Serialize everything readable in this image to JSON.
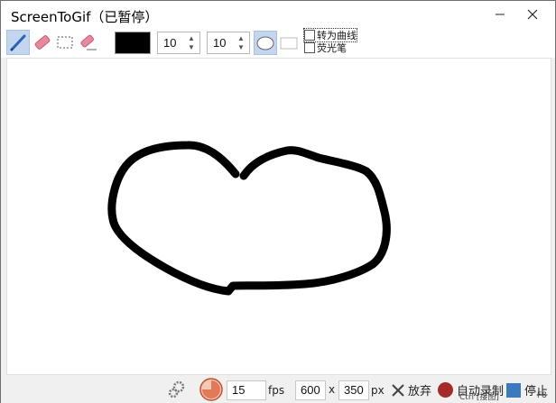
{
  "window": {
    "title": "ScreenToGif（已暂停）"
  },
  "toolbar": {
    "pen_color": "#000000",
    "spin1_value": "10",
    "spin2_value": "10",
    "convert_curve_label": "转为曲线",
    "highlighter_label": "荧光笔",
    "accent": "#c4d5ef"
  },
  "statusbar": {
    "fps_value": "15",
    "fps_label": "fps",
    "width_value": "600",
    "times_label": "x",
    "height_value": "350",
    "px_label": "px",
    "discard_label": "放弃",
    "record_label": "自动录制",
    "record_shortcut": "Ctrl [接图]",
    "stop_label": "停止",
    "stop_shortcut": "F8",
    "record_color": "#a52a2a",
    "stop_color": "#3a7bbf"
  }
}
